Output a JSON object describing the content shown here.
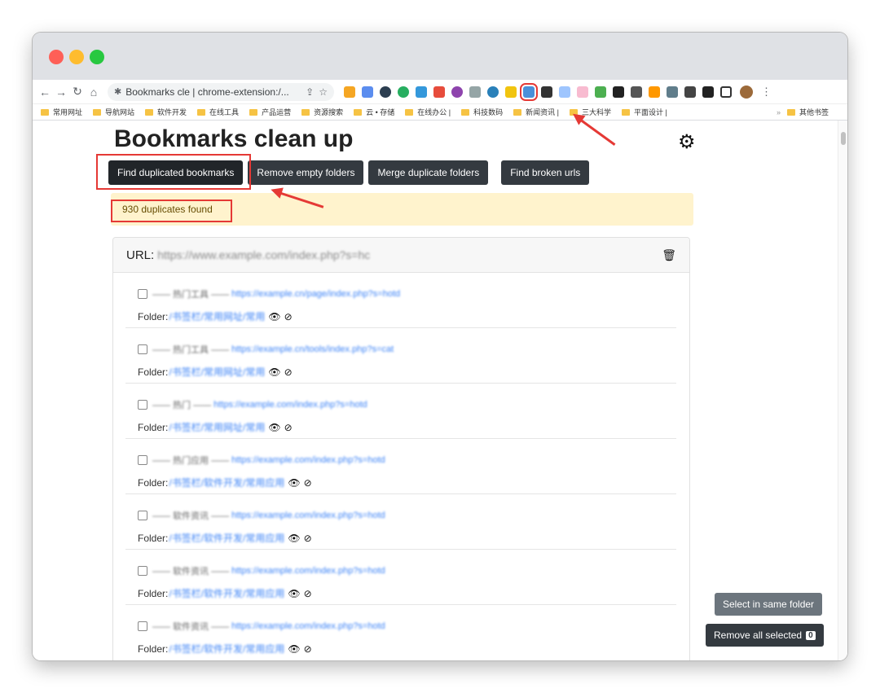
{
  "browser": {
    "omnibox_text": "Bookmarks cle | chrome-extension:/...",
    "bookmarks_bar": [
      "常用网址",
      "导航网站",
      "软件开发",
      "在线工具",
      "产品运营",
      "资源搜索",
      "云 • 存储",
      "在线办公 |",
      "科技数码",
      "新闻资讯 |",
      "三大科学",
      "平面设计 |"
    ],
    "overflow_label": "»",
    "other_bookmarks": "其他书签"
  },
  "page": {
    "title": "Bookmarks clean up"
  },
  "actions": {
    "find_duplicated": "Find duplicated bookmarks",
    "remove_empty": "Remove empty folders",
    "merge_duplicate": "Merge duplicate folders",
    "find_broken": "Find broken urls"
  },
  "alert": {
    "text": "930 duplicates found"
  },
  "card": {
    "url_label": "URL:",
    "url_value": "https://www.example.com/index.php?s=hc"
  },
  "items": [
    {
      "title": "—— 热门工具 ——",
      "url": "https://example.cn/page/index.php?s=hotd",
      "folder_label": "Folder:",
      "folder_path": "/书签栏/常用网址/常用"
    },
    {
      "title": "—— 热门工具 ——",
      "url": "https://example.cn/tools/index.php?s=cat",
      "folder_label": "Folder:",
      "folder_path": "/书签栏/常用网址/常用"
    },
    {
      "title": "—— 热门 ——",
      "url": "https://example.com/index.php?s=hotd",
      "folder_label": "Folder:",
      "folder_path": "/书签栏/常用网址/常用"
    },
    {
      "title": "—— 热门应用 ——",
      "url": "https://example.com/index.php?s=hotd",
      "folder_label": "Folder:",
      "folder_path": "/书签栏/软件开发/常用应用"
    },
    {
      "title": "—— 软件资讯 ——",
      "url": "https://example.com/index.php?s=hotd",
      "folder_label": "Folder:",
      "folder_path": "/书签栏/软件开发/常用应用"
    },
    {
      "title": "—— 软件资讯 ——",
      "url": "https://example.com/index.php?s=hotd",
      "folder_label": "Folder:",
      "folder_path": "/书签栏/软件开发/常用应用"
    },
    {
      "title": "—— 软件资讯 ——",
      "url": "https://example.com/index.php?s=hotd",
      "folder_label": "Folder:",
      "folder_path": "/书签栏/软件开发/常用应用"
    }
  ],
  "side": {
    "select_same_folder": "Select in same folder",
    "remove_all_selected": "Remove all selected",
    "selected_count": "0"
  },
  "icons": {
    "settings": "gear-icon",
    "delete": "trash-icon",
    "view": "eye-icon",
    "hide": "eye-slash-icon"
  },
  "colors": {
    "dark_button": "#343a40",
    "alert_bg": "#fff3cd",
    "annotation": "#e53935",
    "link": "#3b82f6"
  }
}
